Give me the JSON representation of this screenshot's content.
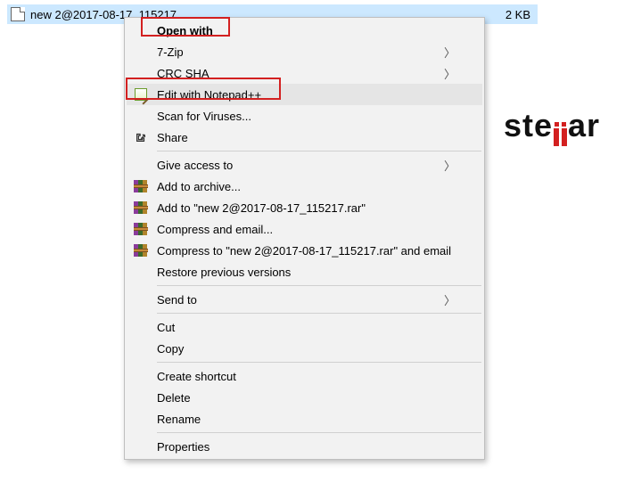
{
  "file": {
    "name": "new 2@2017-08-17_115217",
    "size": "2 KB"
  },
  "menu": {
    "open_with": "Open with",
    "seven_zip": "7-Zip",
    "crc_sha": "CRC SHA",
    "edit_npp": "Edit with Notepad++",
    "scan_viruses": "Scan for Viruses...",
    "share": "Share",
    "give_access": "Give access to",
    "add_archive": "Add to archive...",
    "add_to_rar": "Add to \"new 2@2017-08-17_115217.rar\"",
    "compress_email": "Compress and email...",
    "compress_to_email": "Compress to \"new 2@2017-08-17_115217.rar\" and email",
    "restore_prev": "Restore previous versions",
    "send_to": "Send to",
    "cut": "Cut",
    "copy": "Copy",
    "create_shortcut": "Create shortcut",
    "delete": "Delete",
    "rename": "Rename",
    "properties": "Properties"
  },
  "logo": {
    "pre": "ste",
    "post": "ar"
  }
}
